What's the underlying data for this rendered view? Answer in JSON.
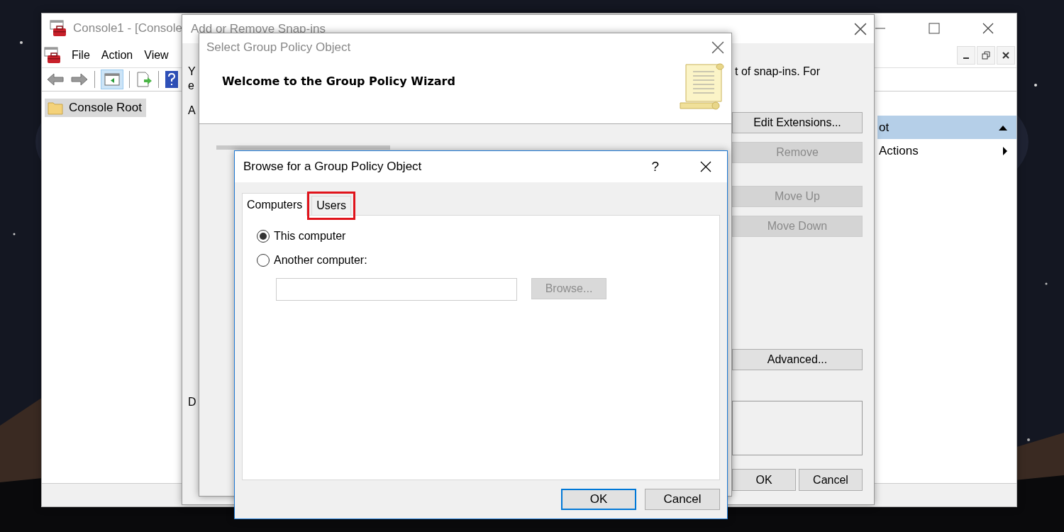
{
  "console_window": {
    "title": "Console1 - [Console",
    "menu": [
      "File",
      "Action",
      "View"
    ],
    "tree": [
      {
        "label": "Console Root",
        "selected": true
      }
    ],
    "actions_pane": [
      {
        "label": "ot",
        "kind": "header"
      },
      {
        "label": "Actions",
        "kind": "submenu"
      }
    ]
  },
  "snapins_dialog": {
    "title": "Add or Remove Snap-ins",
    "fragments_left": [
      "Y",
      "e",
      "A",
      "D"
    ],
    "description": "t of snap-ins. For",
    "buttons": [
      {
        "label": "Edit Extensions...",
        "disabled": false
      },
      {
        "label": "Remove",
        "disabled": true
      },
      {
        "label": "Move Up",
        "disabled": true
      },
      {
        "label": "Move Down",
        "disabled": true
      },
      {
        "label": "Advanced...",
        "disabled": false
      }
    ],
    "footer_buttons": [
      "OK",
      "Cancel"
    ]
  },
  "gpo_wizard": {
    "title": "Select Group Policy Object",
    "heading": "Welcome to the Group Policy Wizard"
  },
  "browse_dialog": {
    "title": "Browse for a Group Policy Object",
    "help": "?",
    "tabs": [
      {
        "label": "Computers",
        "selected": true,
        "highlighted": false
      },
      {
        "label": "Users",
        "selected": false,
        "highlighted": true
      }
    ],
    "options": [
      {
        "label": "This computer",
        "selected": true
      },
      {
        "label": "Another computer:",
        "selected": false
      }
    ],
    "computer_field": {
      "disabled": true
    },
    "browse_button": {
      "label": "Browse...",
      "disabled": true
    },
    "buttons": [
      {
        "label": "OK",
        "default": true
      },
      {
        "label": "Cancel",
        "default": false
      }
    ]
  }
}
